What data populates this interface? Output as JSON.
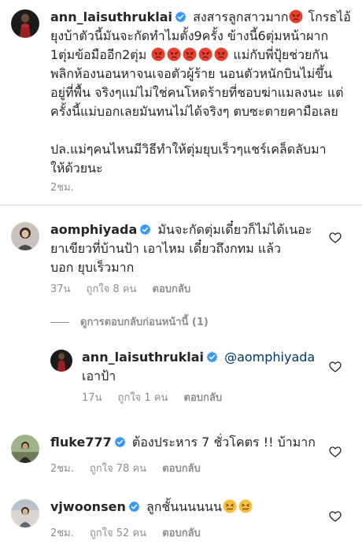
{
  "caption": {
    "username": "ann_laisuthruklai",
    "lines": [
      "สงสารลูกสาวมาก",
      "โกรธไอ้",
      "ยุงบ้าตัวนี้มันจะกัดทำไมตั้ง9ครั้ง ข้างนี้6ตุ่มหน้าผาก",
      "1ตุ่มข้อมืออีก2ตุ่ม",
      "แม่กับพี่ปุ้ยช่วยกัน",
      "พลิกห้องนอนหาจนเจอตัวผู้ร้าย นอนตัวหนักบินไม่ขึ้น",
      "อยู่ที่พื้น จริงๆแม่ไม่ใช่คนโหดร้ายที่ชอบฆ่าแมลงนะ แต่",
      "ครั้งนี้แม่บอกเลยมันทนไม่ได้จริงๆ ตบซะตายคามือเลย",
      "",
      "ปล.แม่ๆคนไหนมีวิธีทำให้ตุ่มยุบเร็วๆแชร์เคล็ดลับมา",
      "ให้ด้วยนะ"
    ],
    "time": "2ชม."
  },
  "comments": [
    {
      "username": "aomphiyada",
      "lines": [
        "มันจะกัดตุ่มเดี๋ยวก็ไม่ได้เนอะ",
        "ยาเขียวที่บ้านป้า เอาไหม เดี๋ยวถึงกทม แล้ว",
        "บอก ยุบเร็วมาก"
      ],
      "time": "37น",
      "likes": "ถูกใจ 8 คน",
      "reply": "ตอบกลับ"
    },
    {
      "username": "ann_laisuthruklai",
      "mention": "@aomphiyada",
      "lines": [
        "เอาป้า"
      ],
      "time": "17น",
      "likes": "ถูกใจ 1 คน",
      "reply": "ตอบกลับ"
    },
    {
      "username": "fluke777",
      "lines": [
        "ต้องประหาร 7 ชั่วโคตร !! บ้ามาก"
      ],
      "time": "2ชม.",
      "likes": "ถูกใจ 78 คน",
      "reply": "ตอบกลับ"
    },
    {
      "username": "vjwoonsen",
      "lines": [
        "ลูกชั้นนนนนน"
      ],
      "time": "2ชม.",
      "likes": "ถูกใจ 52 คน",
      "reply": "ตอบกลับ"
    }
  ],
  "view_replies": "ดูการตอบกลับก่อนหน้านี้ (1)",
  "colors": {
    "text": "#262626",
    "muted": "#8e8e8e",
    "mention": "#003569",
    "verified": "#3897f0",
    "divider": "#dbdbdb"
  },
  "icons": [
    "verified-badge-icon",
    "angry-face-emoji",
    "heart-outline-icon",
    "confounded-face-emoji"
  ]
}
